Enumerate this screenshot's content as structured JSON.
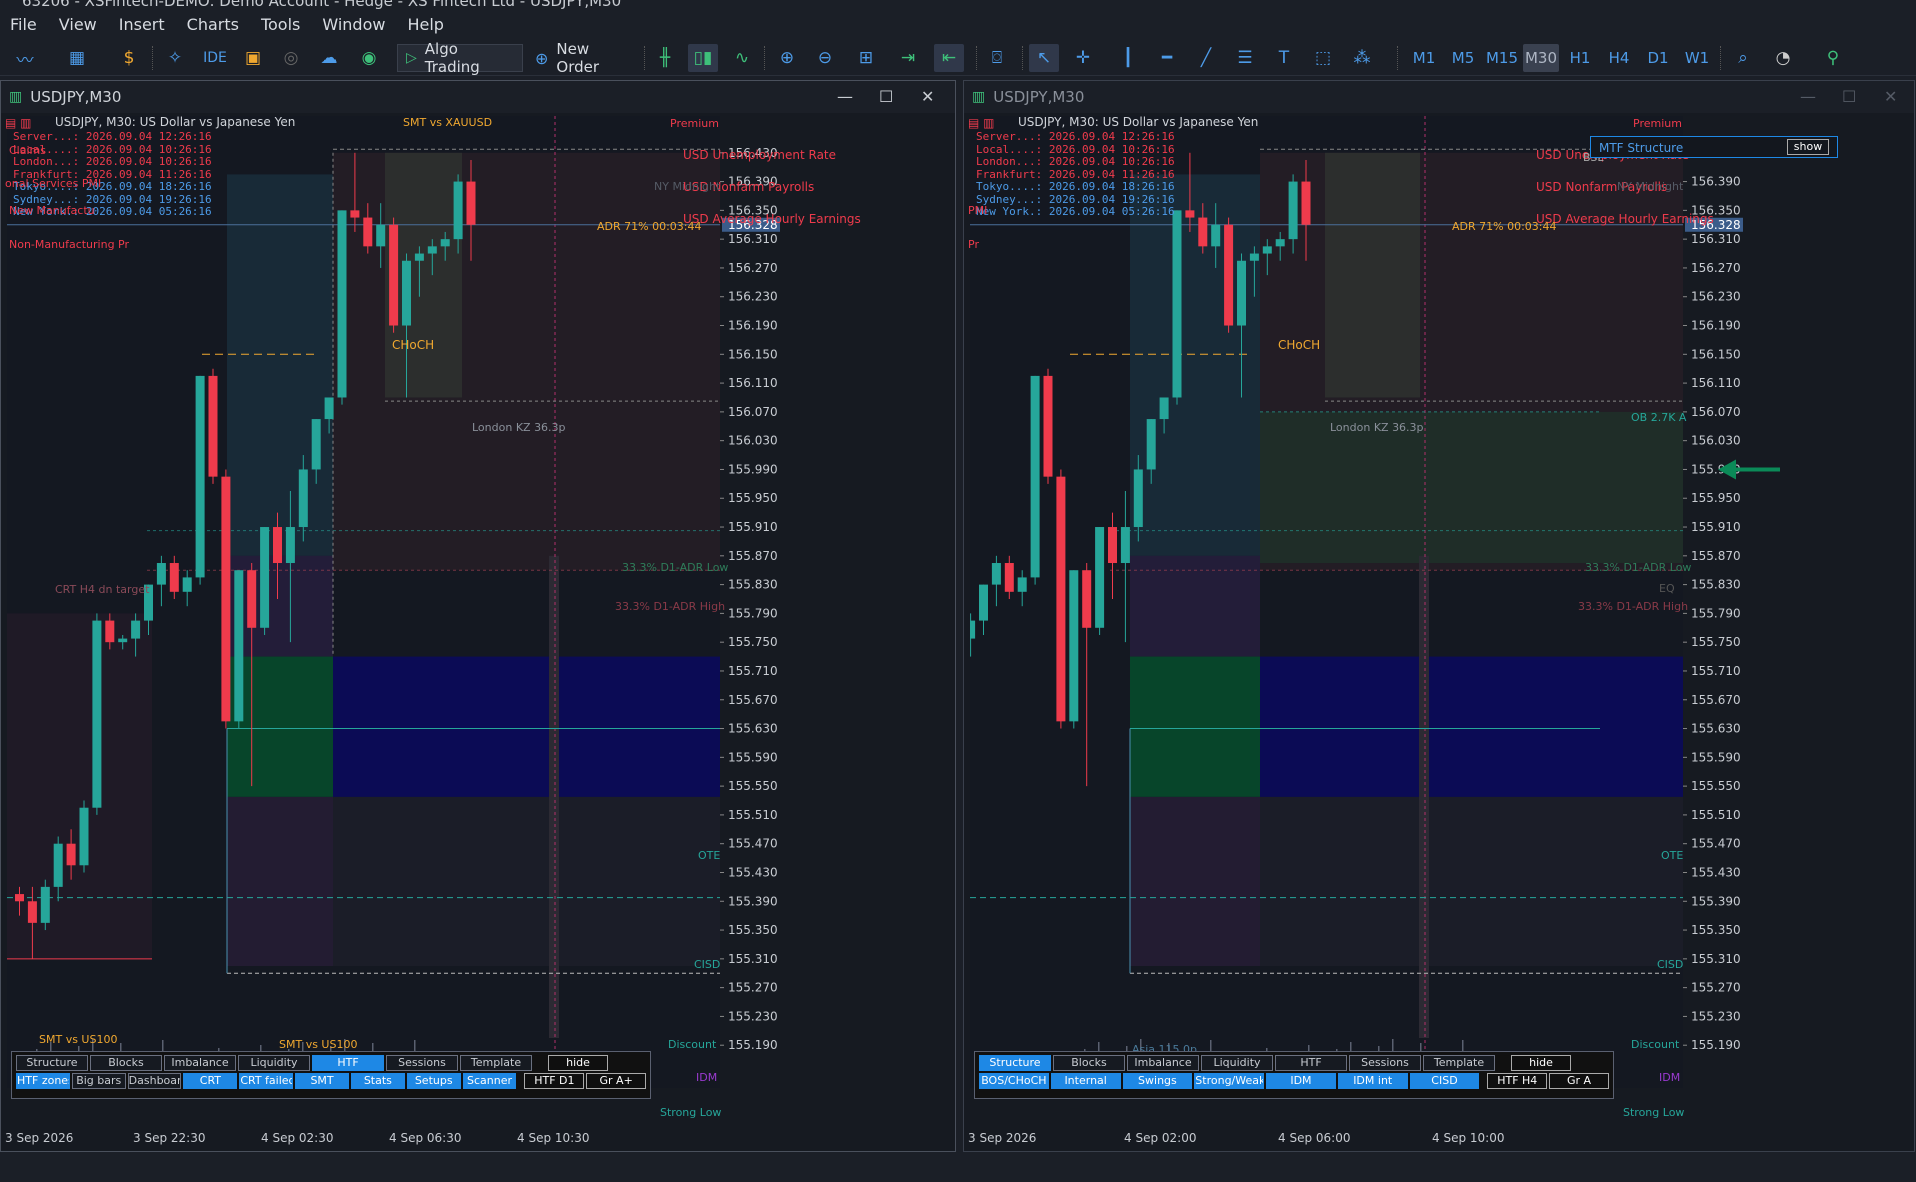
{
  "window": {
    "title": "63206 - XSFintech-DEMO: Demo Account - Hedge - XS Fintech Ltd - USDJPY,M30"
  },
  "menu": [
    "File",
    "View",
    "Insert",
    "Charts",
    "Tools",
    "Window",
    "Help"
  ],
  "toolbar": {
    "algo_trading": "Algo Trading",
    "new_order": "New Order",
    "ide": "IDE",
    "timeframes": [
      "M1",
      "M5",
      "M15",
      "M30",
      "H1",
      "H4",
      "D1",
      "W1"
    ],
    "active_timeframe": "M30",
    "notification_count": "1"
  },
  "colors": {
    "bull": "#26a69a",
    "bear": "#ef3b4c",
    "accent": "#1e88e5"
  },
  "chart_data": {
    "type": "candlestick",
    "symbol": "USDJPY,M30",
    "header": "USDJPY, M30:  US Dollar vs Japanese Yen",
    "current_price": "156.328",
    "ylim": [
      155.15,
      156.47
    ],
    "y_ticks": [
      "156.430",
      "156.390",
      "156.350",
      "156.310",
      "156.270",
      "156.230",
      "156.190",
      "156.150",
      "156.110",
      "156.070",
      "156.030",
      "155.990",
      "155.950",
      "155.910",
      "155.870",
      "155.830",
      "155.790",
      "155.750",
      "155.710",
      "155.670",
      "155.630",
      "155.590",
      "155.550",
      "155.510",
      "155.470",
      "155.430",
      "155.390",
      "155.350",
      "155.310",
      "155.270",
      "155.230",
      "155.190"
    ],
    "candles": [
      {
        "o": 155.4,
        "h": 155.41,
        "l": 155.37,
        "c": 155.39
      },
      {
        "o": 155.39,
        "h": 155.41,
        "l": 155.31,
        "c": 155.36
      },
      {
        "o": 155.36,
        "h": 155.42,
        "l": 155.35,
        "c": 155.41
      },
      {
        "o": 155.41,
        "h": 155.48,
        "l": 155.39,
        "c": 155.47
      },
      {
        "o": 155.47,
        "h": 155.49,
        "l": 155.42,
        "c": 155.44
      },
      {
        "o": 155.44,
        "h": 155.53,
        "l": 155.43,
        "c": 155.52
      },
      {
        "o": 155.52,
        "h": 155.79,
        "l": 155.51,
        "c": 155.78
      },
      {
        "o": 155.78,
        "h": 155.79,
        "l": 155.74,
        "c": 155.75
      },
      {
        "o": 155.75,
        "h": 155.76,
        "l": 155.74,
        "c": 155.755
      },
      {
        "o": 155.755,
        "h": 155.79,
        "l": 155.73,
        "c": 155.78
      },
      {
        "o": 155.78,
        "h": 155.83,
        "l": 155.76,
        "c": 155.83
      },
      {
        "o": 155.83,
        "h": 155.87,
        "l": 155.8,
        "c": 155.86
      },
      {
        "o": 155.86,
        "h": 155.87,
        "l": 155.81,
        "c": 155.82
      },
      {
        "o": 155.82,
        "h": 155.85,
        "l": 155.8,
        "c": 155.84
      },
      {
        "o": 155.84,
        "h": 156.12,
        "l": 155.83,
        "c": 156.12
      },
      {
        "o": 156.12,
        "h": 156.13,
        "l": 155.97,
        "c": 155.98
      },
      {
        "o": 155.98,
        "h": 155.99,
        "l": 155.63,
        "c": 155.64
      },
      {
        "o": 155.64,
        "h": 155.85,
        "l": 155.63,
        "c": 155.85
      },
      {
        "o": 155.85,
        "h": 155.86,
        "l": 155.55,
        "c": 155.77
      },
      {
        "o": 155.77,
        "h": 155.91,
        "l": 155.76,
        "c": 155.91
      },
      {
        "o": 155.91,
        "h": 155.93,
        "l": 155.81,
        "c": 155.86
      },
      {
        "o": 155.86,
        "h": 155.96,
        "l": 155.75,
        "c": 155.91
      },
      {
        "o": 155.91,
        "h": 156.01,
        "l": 155.89,
        "c": 155.99
      },
      {
        "o": 155.99,
        "h": 156.06,
        "l": 155.97,
        "c": 156.06
      },
      {
        "o": 156.06,
        "h": 156.08,
        "l": 156.04,
        "c": 156.09
      },
      {
        "o": 156.09,
        "h": 156.35,
        "l": 156.08,
        "c": 156.35
      },
      {
        "o": 156.35,
        "h": 156.43,
        "l": 156.32,
        "c": 156.34
      },
      {
        "o": 156.34,
        "h": 156.36,
        "l": 156.29,
        "c": 156.3
      },
      {
        "o": 156.3,
        "h": 156.36,
        "l": 156.27,
        "c": 156.33
      },
      {
        "o": 156.33,
        "h": 156.34,
        "l": 156.18,
        "c": 156.19
      },
      {
        "o": 156.19,
        "h": 156.29,
        "l": 156.09,
        "c": 156.28
      },
      {
        "o": 156.28,
        "h": 156.3,
        "l": 156.23,
        "c": 156.29
      },
      {
        "o": 156.29,
        "h": 156.31,
        "l": 156.26,
        "c": 156.3
      },
      {
        "o": 156.3,
        "h": 156.32,
        "l": 156.28,
        "c": 156.31
      },
      {
        "o": 156.31,
        "h": 156.4,
        "l": 156.29,
        "c": 156.39
      },
      {
        "o": 156.39,
        "h": 156.42,
        "l": 156.28,
        "c": 156.33
      }
    ],
    "levels": {
      "premium": 156.435,
      "eq_line": 155.63,
      "cisd": 155.395,
      "discount": 155.29,
      "choch": 156.15,
      "london_kz": 156.085,
      "adr_low": 155.905,
      "adr_high": 155.85
    }
  },
  "left": {
    "title": "USDJPY,M30",
    "clock_lines": [
      "Server...: 2026.09.04 12:26:16",
      "Local....: 2026.09.04 10:26:16",
      "London...: 2026.09.04 10:26:16",
      "Frankfurt: 2026.09.04 11:26:16",
      "Tokyo....: 2026.09.04 18:26:16",
      "Sydney...: 2026.09.04 19:26:16",
      "New York.: 2026.09.04 05:26:16"
    ],
    "side_notes": [
      "Claims",
      "onal Services PMI",
      "New Manufactu",
      "Non-Manufacturing Pr"
    ],
    "labels": {
      "premium": "Premium",
      "news1": "USD Unemployment Rate",
      "news2": "USD Nonfarm Payrolls",
      "news3": "USD Average Hourly Earnings",
      "ny_midnight": "NY Midnight",
      "adr": "ADR 71%  00:03:44",
      "smt_top": "SMT vs XAUUSD",
      "choch": "CHoCH",
      "london_kz": "London KZ  36.3p",
      "adr_low": "33.3% D1-ADR Low",
      "adr_high": "33.3% D1-ADR High",
      "crt": "CRT H4 dn  target",
      "ote": "OTE",
      "cisd": "CISD",
      "smt_bl": "SMT vs US100",
      "smt_bm": "SMT vs US100",
      "discount": "Discount",
      "idm": "IDM",
      "strong_low": "Strong Low"
    },
    "dates": [
      "3 Sep 2026",
      "3 Sep 22:30",
      "4 Sep 02:30",
      "4 Sep 06:30",
      "4 Sep 10:30"
    ],
    "panel_row1": [
      "Structure",
      "Blocks",
      "Imbalance",
      "Liquidity",
      "HTF",
      "Sessions",
      "Template",
      "hide"
    ],
    "panel_row2": [
      "HTF zones",
      "Big bars",
      "Dashboard",
      "CRT",
      "CRT failed",
      "SMT",
      "Stats",
      "Setups",
      "Scanner",
      "HTF D1",
      "Gr A+"
    ]
  },
  "right": {
    "title": "USDJPY,M30",
    "clock_lines": [
      "Server...: 2026.09.04 12:26:16",
      "Local....: 2026.09.04 10:26:16",
      "London...: 2026.09.04 10:26:16",
      "Frankfurt: 2026.09.04 11:26:16",
      "Tokyo....: 2026.09.04 18:26:16",
      "Sydney...: 2026.09.04 19:26:16",
      "New York.: 2026.09.04 05:26:16"
    ],
    "side_notes": [
      "PMI",
      "Pr"
    ],
    "labels": {
      "premium": "Premium",
      "news1": "USD Unemployment Rate",
      "news2": "USD Nonfarm Payrolls",
      "news3": "USD Average Hourly Earnings",
      "ny_midnight": "NY Midnight",
      "adr": "ADR 71%  00:03:44",
      "choch": "CHoCH",
      "london_kz": "London KZ  36.3p",
      "ob": "OB 2.7K A",
      "bsl": "BSL",
      "adr_low": "33.3% D1-ADR Low",
      "adr_high": "33.3% D1-ADR High",
      "eq": "EQ",
      "ote": "OTE",
      "cisd": "CISD",
      "asia": "Asia  115.0p",
      "discount": "Discount",
      "idm": "IDM",
      "strong_low": "Strong Low"
    },
    "mtf": {
      "label": "MTF Structure",
      "button": "show"
    },
    "dates": [
      "3 Sep 2026",
      "4 Sep 02:00",
      "4 Sep 06:00",
      "4 Sep 10:00"
    ],
    "panel_row1": [
      "Structure",
      "Blocks",
      "Imbalance",
      "Liquidity",
      "HTF",
      "Sessions",
      "Template",
      "hide"
    ],
    "panel_row2": [
      "BOS/CHoCH",
      "Internal",
      "Swings",
      "Strong/Weak",
      "IDM",
      "IDM int",
      "CISD",
      "HTF H4",
      "Gr A"
    ]
  }
}
